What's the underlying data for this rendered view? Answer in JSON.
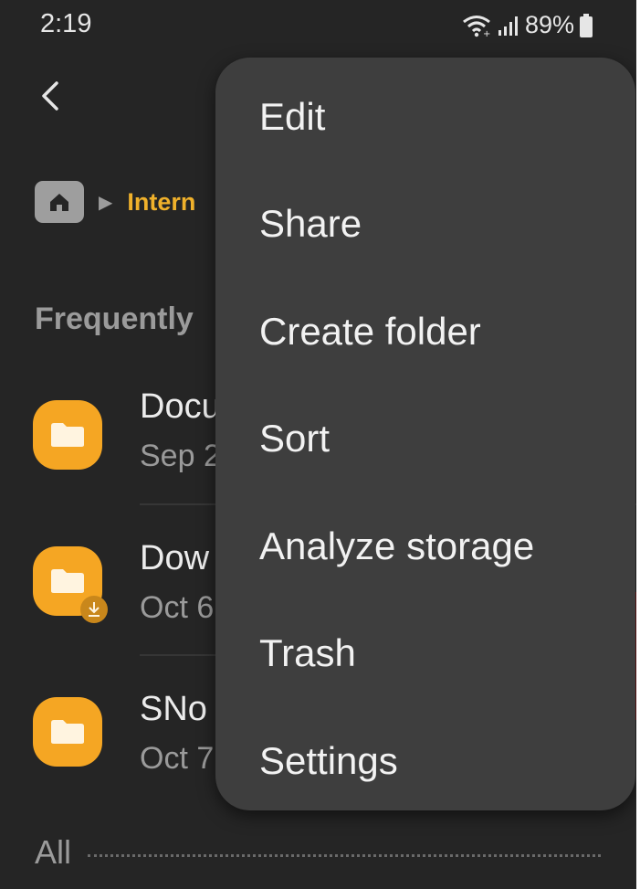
{
  "status_bar": {
    "time": "2:19",
    "battery": "89%",
    "icons": [
      "wifi-calling-icon",
      "signal-icon",
      "battery-icon"
    ]
  },
  "header": {
    "back_icon": "back-arrow-icon"
  },
  "breadcrumb": {
    "home_icon": "home-icon",
    "separator": "▶",
    "current": "Intern"
  },
  "frequent": {
    "title": "Frequently",
    "items": [
      {
        "name": "Docu",
        "date": "Sep 2",
        "icon": "folder-icon"
      },
      {
        "name": "Dow",
        "date": "Oct 6",
        "icon": "folder-icon",
        "badge": "download-icon"
      },
      {
        "name": "SNo",
        "date": "Oct 7",
        "icon": "folder-icon"
      }
    ]
  },
  "all_section": {
    "title": "All"
  },
  "menu": {
    "items": [
      "Edit",
      "Share",
      "Create folder",
      "Sort",
      "Analyze storage",
      "Trash",
      "Settings"
    ]
  },
  "colors": {
    "background": "#252525",
    "menu": "#3e3e3e",
    "accent": "#f0b12b",
    "folder": "#f5a623"
  }
}
